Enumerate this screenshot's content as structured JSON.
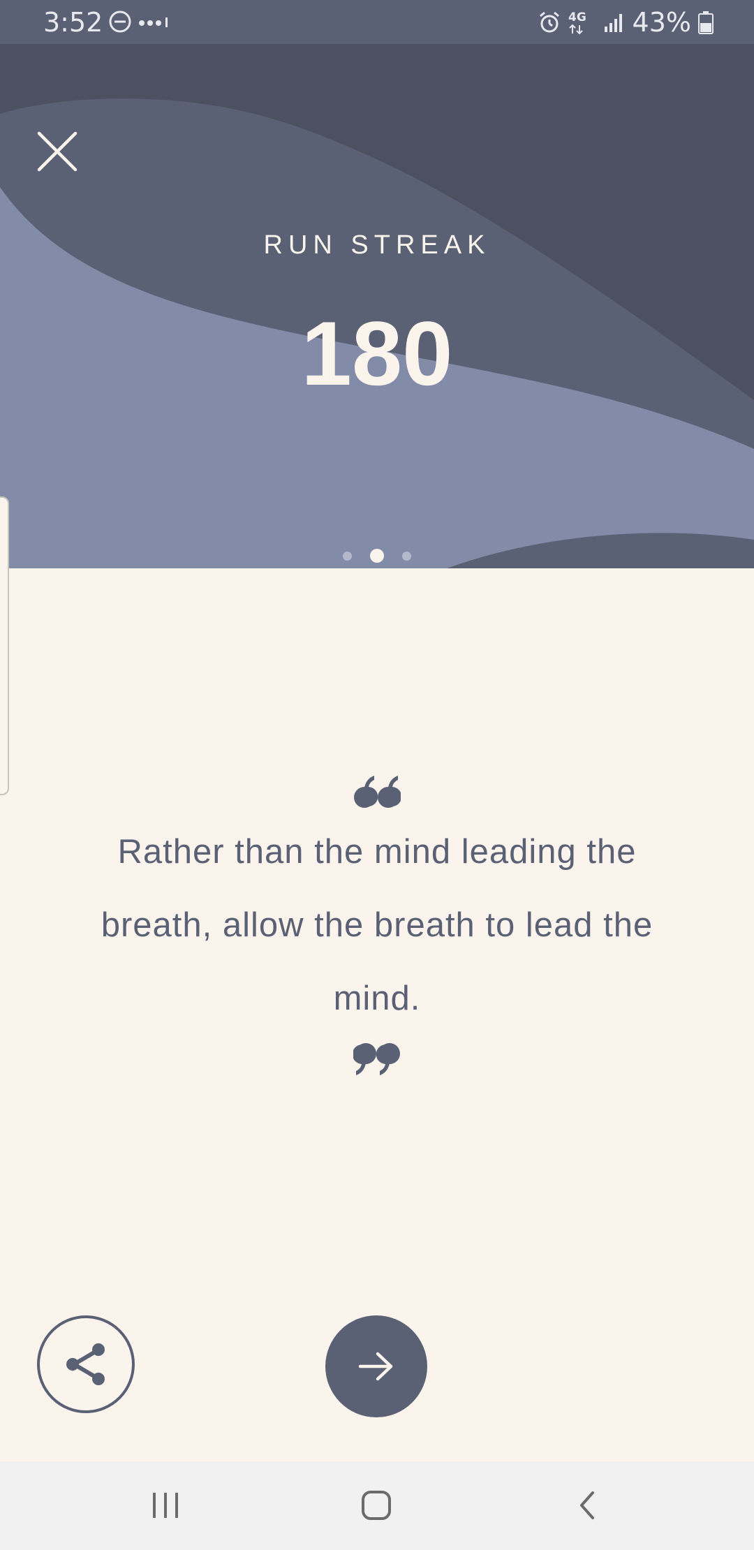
{
  "status_bar": {
    "time": "3:52",
    "battery": "43%",
    "network": "4G",
    "icons": [
      "do-not-disturb-icon",
      "more-notifications-icon",
      "alarm-icon",
      "4g-lte-icon",
      "signal-icon",
      "battery-icon"
    ]
  },
  "header": {
    "title": "RUN STREAK",
    "value": "180",
    "pager": {
      "pages": 3,
      "active_index": 1
    }
  },
  "quote": {
    "text": "Rather than the mind leading the breath, allow the breath to lead the mind."
  },
  "actions": {
    "share_icon": "share-icon",
    "next_icon": "arrow-right-icon"
  },
  "nav_bar": {
    "items": [
      "recent-apps-icon",
      "home-icon",
      "back-icon"
    ]
  },
  "colors": {
    "status_bar": "#5b6175",
    "header_dark": "#4c5162",
    "header_mid": "#5b6175",
    "header_light": "#828ca9",
    "cream": "#fbf4ec",
    "text": "#5b6175",
    "nav_bar": "#f1f1f1"
  }
}
